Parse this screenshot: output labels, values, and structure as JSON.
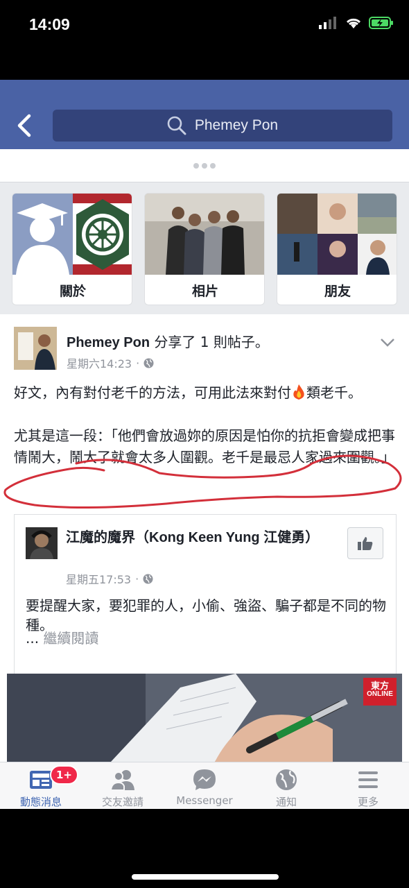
{
  "status": {
    "time": "14:09"
  },
  "header": {
    "search_text": "Phemey Pon"
  },
  "tiles": [
    {
      "label": "關於"
    },
    {
      "label": "相片"
    },
    {
      "label": "朋友"
    }
  ],
  "post": {
    "author": "Phemey Pon",
    "action": " 分享了 1 則帖子。",
    "time": "星期六14:23",
    "para1a": "好文，內有對付老千的方法，可用此法來對付",
    "para1b": "類老千。",
    "para2": "尤其是這一段：「他們會放過妳的原因是怕你的抗拒會變成把事情鬧大，鬧大了就會太多人圍觀。老千是最忌人家過來圍觀。」"
  },
  "shared": {
    "author": "江魔的魔界（Kong Keen Yung 江健勇）",
    "time": "星期五17:53",
    "text": "要提醒大家，要犯罪的人，小偷、強盜、騙子都是不同的物種。",
    "ellipsis": "... ",
    "more": "繼續閱讀",
    "brand_line1": "東方",
    "brand_line2": "ONLINE"
  },
  "tabbar": {
    "badge": "1+",
    "tabs": [
      {
        "label": "動態消息",
        "icon": "news-feed-icon"
      },
      {
        "label": "交友邀請",
        "icon": "friends-icon"
      },
      {
        "label": "Messenger",
        "icon": "messenger-icon"
      },
      {
        "label": "通知",
        "icon": "globe-icon"
      },
      {
        "label": "更多",
        "icon": "menu-icon"
      }
    ]
  },
  "colors": {
    "header": "#4a62a5",
    "accent": "#4267b2",
    "badge": "#f02849"
  }
}
